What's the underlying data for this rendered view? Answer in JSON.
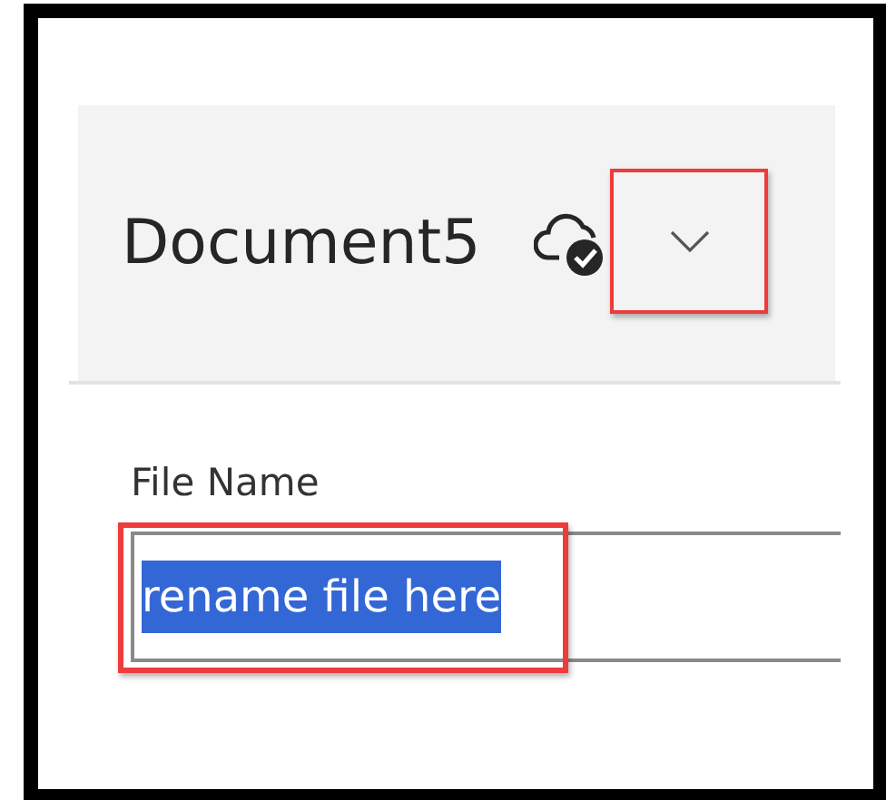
{
  "header": {
    "title": "Document5",
    "dropdown": {
      "highlighted": true
    }
  },
  "file_name_field": {
    "label": "File Name",
    "value": "rename file here",
    "text_selected": true,
    "highlighted": true
  }
}
